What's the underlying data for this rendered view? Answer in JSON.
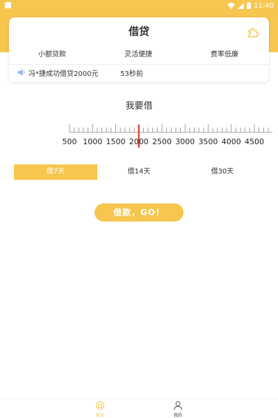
{
  "status_bar": {
    "time": "11:40"
  },
  "card": {
    "title": "借贷",
    "features": [
      "小额贷款",
      "灵活便捷",
      "费率低廉"
    ],
    "notice": {
      "text": "冯*捷成功借贷2000元",
      "time_ago": "53秒前"
    }
  },
  "borrow": {
    "title": "我要借",
    "ruler": {
      "labels": [
        "500",
        "1000",
        "1500",
        "2000",
        "2500",
        "3000",
        "3500",
        "4000",
        "4500"
      ],
      "min": 500,
      "max": 4500,
      "selected": 2000,
      "indicator_color": "#e0201e"
    }
  },
  "tabs": [
    {
      "label": "借7天",
      "active": true
    },
    {
      "label": "借14天",
      "active": false
    },
    {
      "label": "借30天",
      "active": false
    }
  ],
  "go_button": {
    "label": "借款，GO！"
  },
  "bottom_nav": [
    {
      "label": "首页",
      "icon": "home-icon",
      "active": true
    },
    {
      "label": "我的",
      "icon": "user-icon",
      "active": false
    }
  ],
  "colors": {
    "accent": "#f6c64f",
    "indicator": "#e0201e"
  }
}
